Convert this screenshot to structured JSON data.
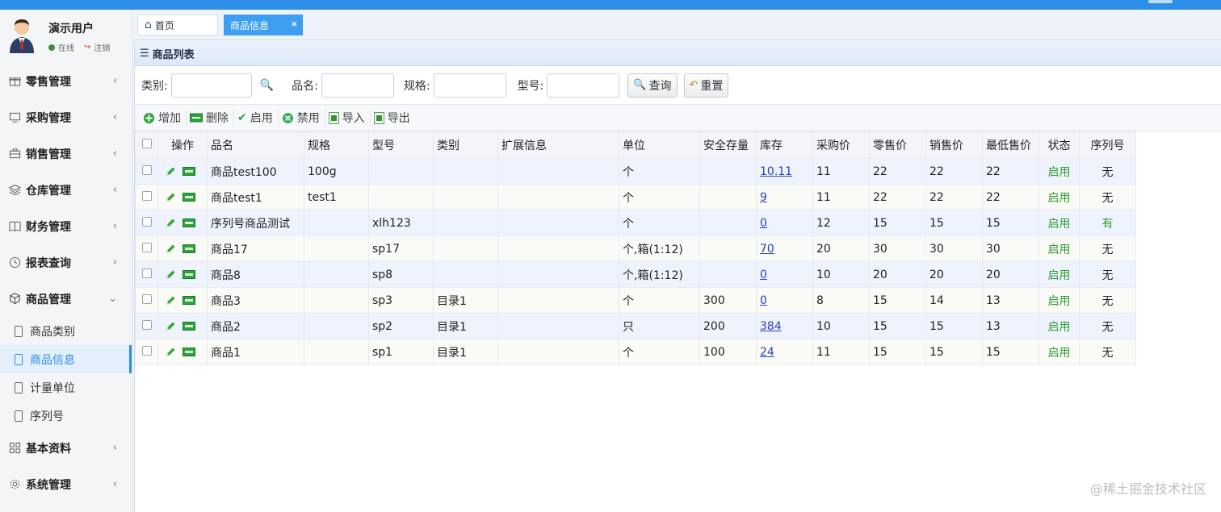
{
  "user": {
    "name": "演示用户",
    "online": "在线",
    "logout": "注销"
  },
  "menu": [
    {
      "label": "零售管理",
      "icon": "gift-icon"
    },
    {
      "label": "采购管理",
      "icon": "monitor-icon"
    },
    {
      "label": "销售管理",
      "icon": "briefcase-icon"
    },
    {
      "label": "仓库管理",
      "icon": "layers-icon"
    },
    {
      "label": "财务管理",
      "icon": "book-icon"
    },
    {
      "label": "报表查询",
      "icon": "clock-icon"
    },
    {
      "label": "商品管理",
      "icon": "cubes-icon",
      "expanded": true
    },
    {
      "label": "基本资料",
      "icon": "grid-icon"
    },
    {
      "label": "系统管理",
      "icon": "gear-icon"
    }
  ],
  "submenu": [
    {
      "label": "商品类别"
    },
    {
      "label": "商品信息",
      "active": true
    },
    {
      "label": "计量单位"
    },
    {
      "label": "序列号"
    }
  ],
  "tabs": {
    "home": "首页",
    "current": "商品信息"
  },
  "panel": {
    "title": "商品列表"
  },
  "search": {
    "category_label": "类别:",
    "name_label": "品名:",
    "spec_label": "规格:",
    "model_label": "型号:",
    "query_button": "查询",
    "reset_button": "重置"
  },
  "toolbar": {
    "add": "增加",
    "delete": "删除",
    "enable": "启用",
    "disable": "禁用",
    "import": "导入",
    "export": "导出"
  },
  "table": {
    "headers": [
      "操作",
      "品名",
      "规格",
      "型号",
      "类别",
      "扩展信息",
      "单位",
      "安全存量",
      "库存",
      "采购价",
      "零售价",
      "销售价",
      "最低售价",
      "状态",
      "序列号"
    ],
    "rows": [
      {
        "name": "商品test100",
        "spec": "100g",
        "model": "",
        "category": "",
        "ext": "",
        "unit": "个",
        "safety": "",
        "stock": "10.11",
        "purchase": "11",
        "retail": "22",
        "sale": "22",
        "min": "22",
        "status": "启用",
        "serial": "无"
      },
      {
        "name": "商品test1",
        "spec": "test1",
        "model": "",
        "category": "",
        "ext": "",
        "unit": "个",
        "safety": "",
        "stock": "9",
        "purchase": "11",
        "retail": "22",
        "sale": "22",
        "min": "22",
        "status": "启用",
        "serial": "无"
      },
      {
        "name": "序列号商品测试",
        "spec": "",
        "model": "xlh123",
        "category": "",
        "ext": "",
        "unit": "个",
        "safety": "",
        "stock": "0",
        "purchase": "12",
        "retail": "15",
        "sale": "15",
        "min": "15",
        "status": "启用",
        "serial": "有"
      },
      {
        "name": "商品17",
        "spec": "",
        "model": "sp17",
        "category": "",
        "ext": "",
        "unit": "个,箱(1:12)",
        "safety": "",
        "stock": "70",
        "purchase": "20",
        "retail": "30",
        "sale": "30",
        "min": "30",
        "status": "启用",
        "serial": "无"
      },
      {
        "name": "商品8",
        "spec": "",
        "model": "sp8",
        "category": "",
        "ext": "",
        "unit": "个,箱(1:12)",
        "safety": "",
        "stock": "0",
        "purchase": "10",
        "retail": "20",
        "sale": "20",
        "min": "20",
        "status": "启用",
        "serial": "无"
      },
      {
        "name": "商品3",
        "spec": "",
        "model": "sp3",
        "category": "目录1",
        "ext": "",
        "unit": "个",
        "safety": "300",
        "stock": "0",
        "purchase": "8",
        "retail": "15",
        "sale": "14",
        "min": "13",
        "status": "启用",
        "serial": "无"
      },
      {
        "name": "商品2",
        "spec": "",
        "model": "sp2",
        "category": "目录1",
        "ext": "",
        "unit": "只",
        "safety": "200",
        "stock": "384",
        "purchase": "10",
        "retail": "15",
        "sale": "15",
        "min": "13",
        "status": "启用",
        "serial": "无"
      },
      {
        "name": "商品1",
        "spec": "",
        "model": "sp1",
        "category": "目录1",
        "ext": "",
        "unit": "个",
        "safety": "100",
        "stock": "24",
        "purchase": "11",
        "retail": "15",
        "sale": "15",
        "min": "15",
        "status": "启用",
        "serial": "无"
      }
    ]
  },
  "watermark": "@稀土掘金技术社区",
  "colors": {
    "accent": "#2d8ee8",
    "status_on": "#2e9e2e",
    "link": "#2a3fbf"
  }
}
